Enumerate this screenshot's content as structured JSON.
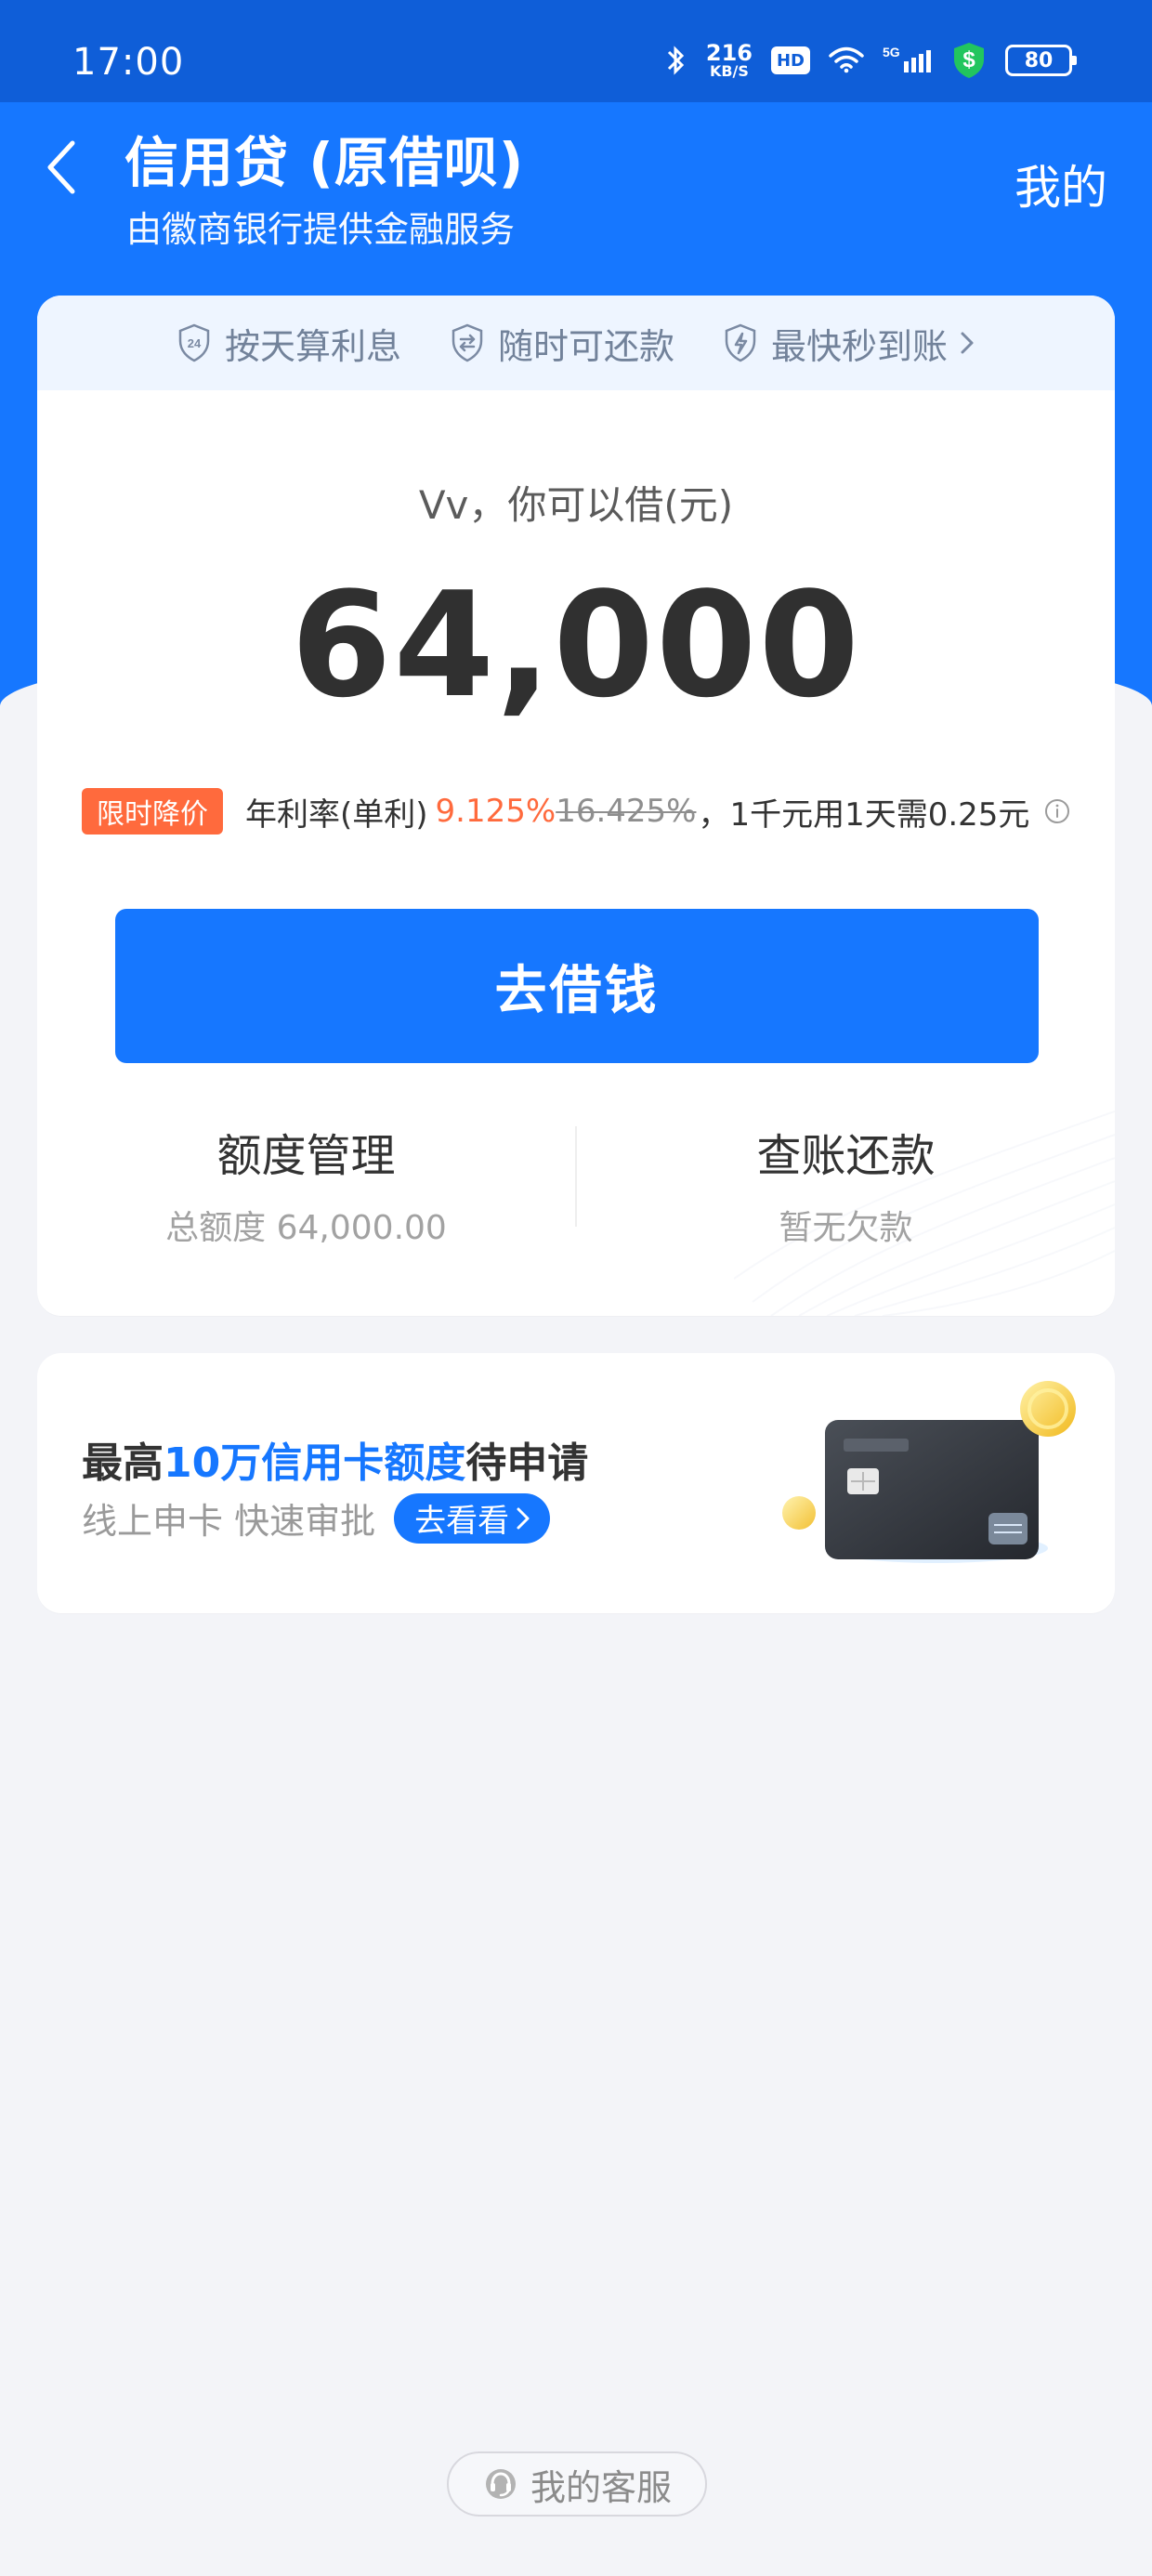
{
  "status": {
    "time": "17:00",
    "speed": "216",
    "speed_unit": "KB/S",
    "hd": "HD",
    "signal": "5G",
    "battery": "80"
  },
  "header": {
    "title": "信用贷 (原借呗)",
    "subtitle": "由徽商银行提供金融服务",
    "my_label": "我的"
  },
  "features": [
    {
      "label": "按天算利息",
      "icon": "24-hour-shield-icon"
    },
    {
      "label": "随时可还款",
      "icon": "transfer-shield-icon"
    },
    {
      "label": "最快秒到账",
      "icon": "lightning-shield-icon"
    }
  ],
  "main": {
    "greeting": "Vv，你可以借(元)",
    "amount": "64,000",
    "limited_tag": "限时降价",
    "rate_label": "年利率(单利)",
    "current_rate": "9.125%",
    "old_rate": "16.425%",
    "rate_note": "，1千元用1天需0.25元",
    "borrow_button": "去借钱"
  },
  "actions": {
    "quota_title": "额度管理",
    "quota_sub": "总额度 64,000.00",
    "repay_title": "查账还款",
    "repay_sub": "暂无欠款"
  },
  "promo": {
    "title_prefix": "最高",
    "title_highlight": "10万信用卡额度",
    "title_suffix": "待申请",
    "subtitle": "线上申卡 快速审批",
    "button": "去看看"
  },
  "support": {
    "label": "我的客服"
  },
  "colors": {
    "primary": "#1677ff",
    "status_bar": "#0f5ed8",
    "accent_orange": "#ff6a3d",
    "background": "#f3f4f8"
  }
}
